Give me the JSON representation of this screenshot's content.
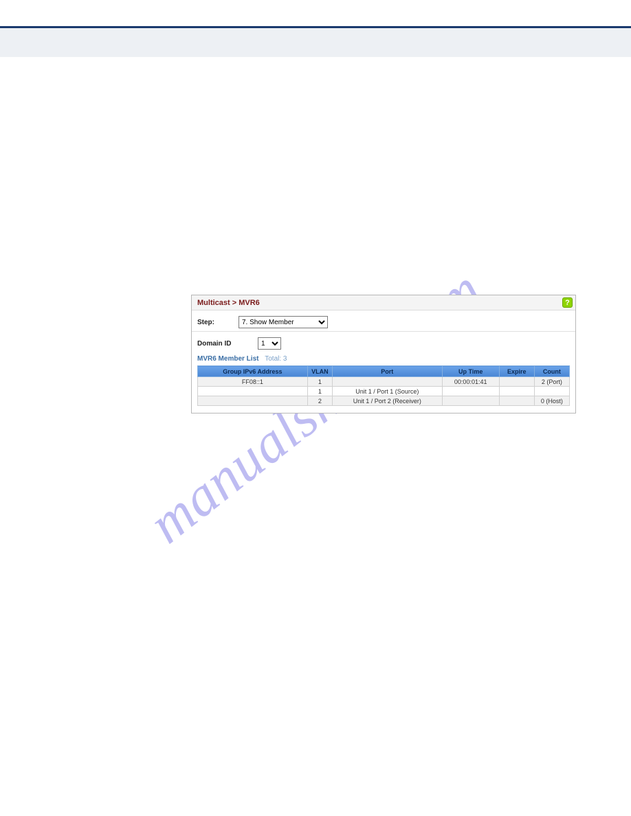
{
  "watermark": "manualshive.com",
  "panel": {
    "breadcrumb": "Multicast > MVR6",
    "help_glyph": "?",
    "step_label": "Step:",
    "step_value": "7. Show Member",
    "domain_label": "Domain ID",
    "domain_value": "1",
    "list_title": "MVR6 Member List",
    "total_label": "Total: 3",
    "columns": {
      "addr": "Group IPv6 Address",
      "vlan": "VLAN",
      "port": "Port",
      "up": "Up Time",
      "exp": "Expire",
      "cnt": "Count"
    },
    "rows": [
      {
        "addr": "FF08::1",
        "vlan": "1",
        "port": "",
        "up": "00:00:01:41",
        "exp": "",
        "cnt": "2 (Port)"
      },
      {
        "addr": "",
        "vlan": "1",
        "port": "Unit 1 / Port 1 (Source)",
        "up": "",
        "exp": "",
        "cnt": ""
      },
      {
        "addr": "",
        "vlan": "2",
        "port": "Unit 1 / Port 2 (Receiver)",
        "up": "",
        "exp": "",
        "cnt": "0 (Host)"
      }
    ]
  }
}
